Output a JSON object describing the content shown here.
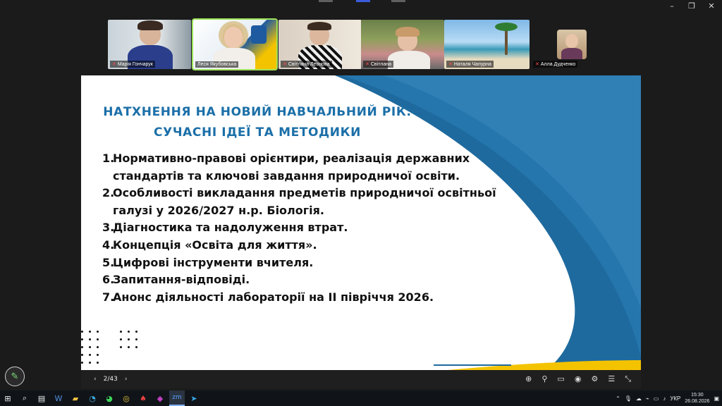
{
  "window": {
    "controls": {
      "minimize": "–",
      "restore": "❐",
      "close": "✕"
    }
  },
  "participants": [
    {
      "name": "Марія Гончарук",
      "muted": true
    },
    {
      "name": "Леся Якубовська",
      "muted": false,
      "active": true
    },
    {
      "name": "Світлана Леонова",
      "muted": true
    },
    {
      "name": "Світлана",
      "muted": true
    },
    {
      "name": "Наталя Чапурна",
      "muted": true
    },
    {
      "name": "Алла Дудченко",
      "muted": true
    }
  ],
  "slide": {
    "title_line1": "НАТХНЕННЯ НА НОВИЙ НАВЧАЛЬНИЙ РІК:",
    "title_line2": "СУЧАСНІ ІДЕЇ ТА МЕТОДИКИ",
    "items": [
      {
        "num": "1.",
        "text": "Нормативно-правові орієнтири, реалізація державних стандартів та ключові завдання природничої освіти."
      },
      {
        "num": "2.",
        "text": "Особливості викладання предметів природничої освітньої галузі у 2026/2027 н.р. Біологія."
      },
      {
        "num": "3.",
        "text": "Діагностика та надолуження втрат."
      },
      {
        "num": "4.",
        "text": "Концепція «Освіта для життя»."
      },
      {
        "num": "5.",
        "text": "Цифрові інструменти вчителя."
      },
      {
        "num": "6.",
        "text": "Запитання-відповіді."
      },
      {
        "num": "7.",
        "text": "Анонс діяльності лабораторії на ІІ півріччя 2026."
      }
    ],
    "colors": {
      "accent_blue": "#1b6fa8",
      "accent_yellow": "#f4c300"
    }
  },
  "presentation_bar": {
    "prev": "‹",
    "page": "2/43",
    "next": "›",
    "controls": [
      "zoom-icon",
      "share-icon",
      "captions-icon",
      "broadcast-icon",
      "settings-icon",
      "menu-icon",
      "exit-fullscreen-icon"
    ]
  },
  "taskbar": {
    "apps": [
      "start",
      "search",
      "task-view",
      "word",
      "files",
      "edge",
      "whatsapp",
      "chrome",
      "acrobat",
      "notes",
      "zoom",
      "telegram"
    ],
    "language": "УКР",
    "time": "15:30",
    "date": "26.08.2026"
  }
}
